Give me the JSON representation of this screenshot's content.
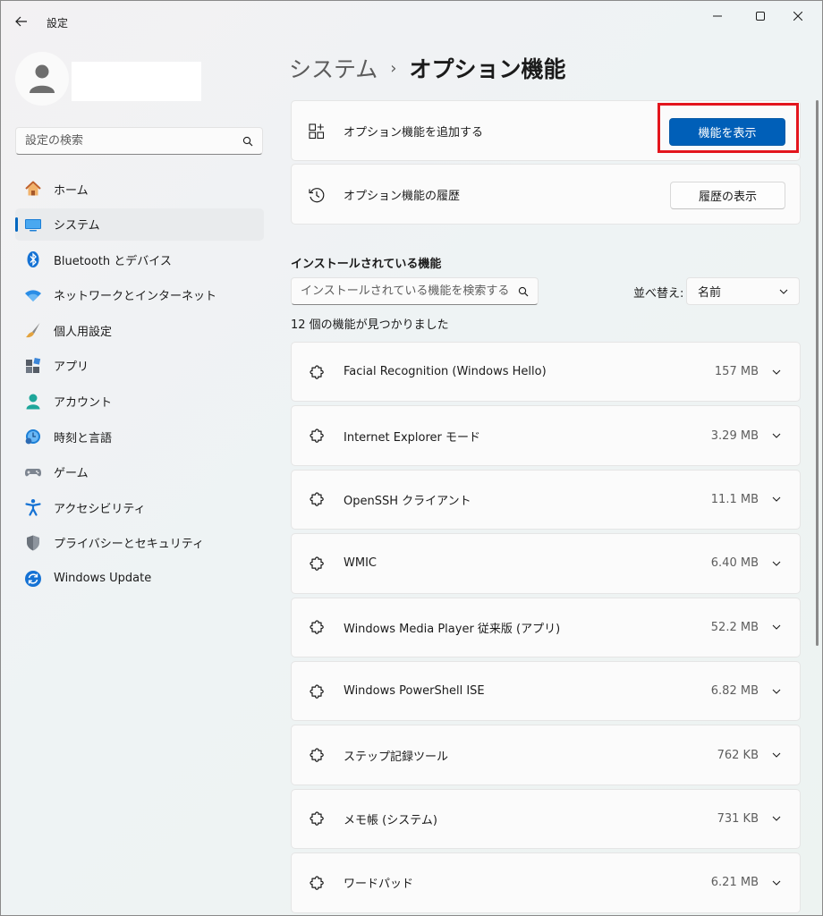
{
  "window": {
    "title": "設定"
  },
  "sidebar": {
    "search_placeholder": "設定の検索",
    "items": [
      {
        "label": "ホーム",
        "icon": "home-icon"
      },
      {
        "label": "システム",
        "icon": "system-icon",
        "active": true
      },
      {
        "label": "Bluetooth とデバイス",
        "icon": "bluetooth-icon"
      },
      {
        "label": "ネットワークとインターネット",
        "icon": "network-icon"
      },
      {
        "label": "個人用設定",
        "icon": "brush-icon"
      },
      {
        "label": "アプリ",
        "icon": "apps-icon"
      },
      {
        "label": "アカウント",
        "icon": "account-icon"
      },
      {
        "label": "時刻と言語",
        "icon": "time-language-icon"
      },
      {
        "label": "ゲーム",
        "icon": "gamepad-icon"
      },
      {
        "label": "アクセシビリティ",
        "icon": "accessibility-icon"
      },
      {
        "label": "プライバシーとセキュリティ",
        "icon": "shield-icon"
      },
      {
        "label": "Windows Update",
        "icon": "windows-update-icon"
      }
    ]
  },
  "breadcrumb": {
    "parent": "システム",
    "separator": "›",
    "current": "オプション機能"
  },
  "add_feature": {
    "label": "オプション機能を追加する",
    "button": "機能を表示"
  },
  "history": {
    "label": "オプション機能の履歴",
    "button": "履歴の表示"
  },
  "installed": {
    "title": "インストールされている機能",
    "search_placeholder": "インストールされている機能を検索する",
    "sort_label": "並べ替え:",
    "sort_value": "名前",
    "count_text": "12 個の機能が見つかりました",
    "features": [
      {
        "name": "Facial Recognition (Windows Hello)",
        "size": "157 MB"
      },
      {
        "name": "Internet Explorer モード",
        "size": "3.29 MB"
      },
      {
        "name": "OpenSSH クライアント",
        "size": "11.1 MB"
      },
      {
        "name": "WMIC",
        "size": "6.40 MB"
      },
      {
        "name": "Windows Media Player 従来版 (アプリ)",
        "size": "52.2 MB"
      },
      {
        "name": "Windows PowerShell ISE",
        "size": "6.82 MB"
      },
      {
        "name": "ステップ記録ツール",
        "size": "762 KB"
      },
      {
        "name": "メモ帳 (システム)",
        "size": "731 KB"
      },
      {
        "name": "ワードパッド",
        "size": "6.21 MB"
      }
    ]
  },
  "colors": {
    "accent": "#005fb8",
    "highlight": "#e3151d"
  }
}
